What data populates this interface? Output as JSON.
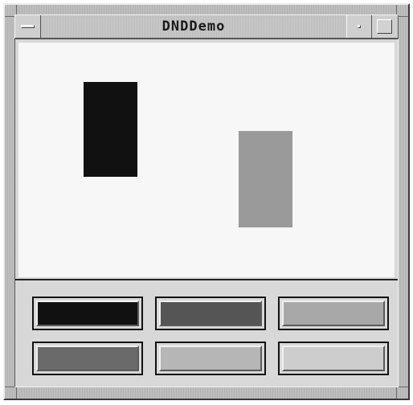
{
  "window": {
    "title": "DNDDemo"
  },
  "canvas": {
    "background": "#f7f7f7",
    "items": [
      {
        "name": "black-rectangle",
        "color": "#111111"
      },
      {
        "name": "gray-rectangle",
        "color": "#9a9a9a"
      }
    ]
  },
  "palette": {
    "swatches": [
      {
        "color": "#111111"
      },
      {
        "color": "#555555"
      },
      {
        "color": "#a8a8a8"
      },
      {
        "color": "#6a6a6a"
      },
      {
        "color": "#b6b6b6"
      },
      {
        "color": "#cdcdcd"
      }
    ]
  }
}
